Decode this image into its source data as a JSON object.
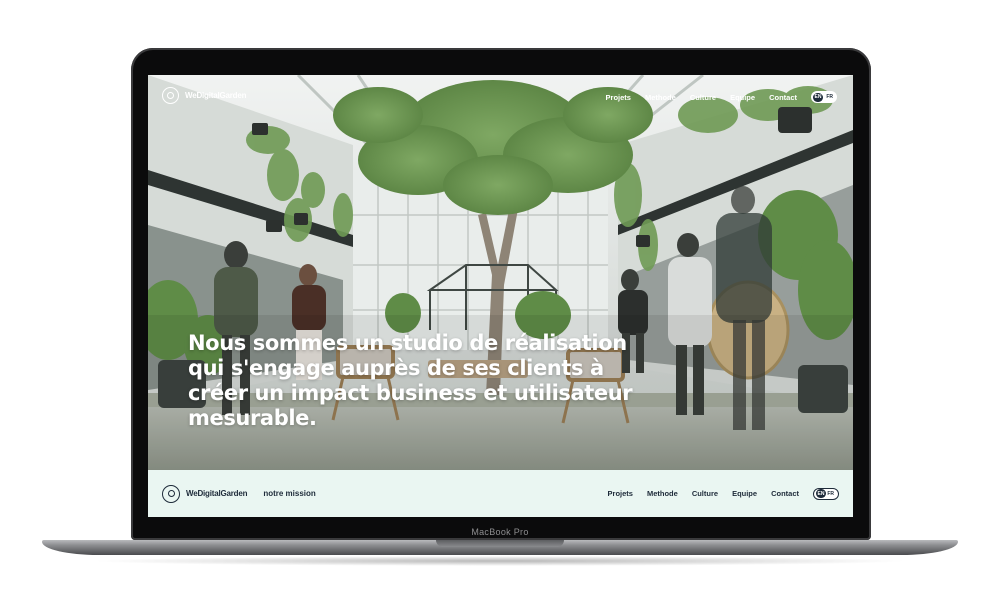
{
  "device": {
    "model_label": "MacBook Pro"
  },
  "hero": {
    "brand": "WeDigitalGarden",
    "nav": [
      "Projets",
      "Methode",
      "Culture",
      "Equipe",
      "Contact"
    ],
    "lang": {
      "active": "EN",
      "inactive": "FR"
    },
    "headline_lines": [
      "Nous sommes un studio de réalisation",
      "qui s'engage auprès de ses clients à",
      "créer un impact business et utilisateur",
      "mesurable."
    ]
  },
  "bottom_bar": {
    "brand": "WeDigitalGarden",
    "mission": "notre mission",
    "nav": [
      "Projets",
      "Methode",
      "Culture",
      "Equipe",
      "Contact"
    ],
    "lang": {
      "active": "EN",
      "inactive": "FR"
    }
  },
  "colors": {
    "accent_dark": "#1e2b3a",
    "bar_background": "#eaf6f2",
    "foliage": "#6f9a55"
  }
}
